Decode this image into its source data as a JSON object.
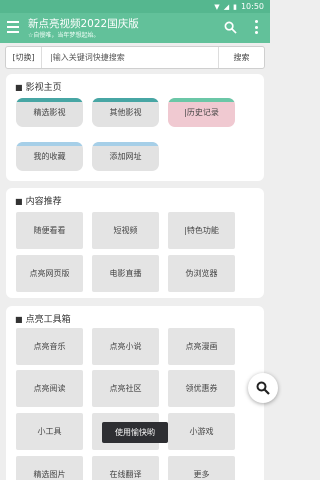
{
  "statusbar": {
    "time": "10:50"
  },
  "appbar": {
    "title": "新点亮视频2022国庆版",
    "subtitle": "☆自慢唯，当年梦想起始。"
  },
  "search": {
    "switch_label": "[切换]",
    "placeholder": "|输入关键词快捷搜索",
    "button_label": "搜索"
  },
  "section1": {
    "title": "影视主页",
    "tiles": [
      "精选影视",
      "其他影视",
      "|历史记录",
      "我的收藏",
      "添加网址"
    ]
  },
  "section2": {
    "title": "内容推荐",
    "tiles": [
      "随便看看",
      "短视频",
      "|特色功能",
      "点亮网页版",
      "电影直播",
      "伪浏览器"
    ]
  },
  "section3": {
    "title": "点亮工具箱",
    "tiles": [
      "点亮音乐",
      "点亮小说",
      "点亮漫画",
      "点亮阅读",
      "点亮社区",
      "领优惠券",
      "小工具",
      "",
      "小游戏",
      "精选图片",
      "在线翻译",
      "更多"
    ]
  },
  "toast": {
    "text": "使用愉快哟"
  },
  "colors": {
    "appbar": "#62c19a",
    "statusbar": "#55b78f",
    "tile_accent": "#47a6a4",
    "history_tile": "#f0c9d1"
  },
  "icons": {
    "menu": "hamburger-icon",
    "search": "search-icon",
    "more": "more-vert-icon",
    "fab": "search-icon"
  }
}
